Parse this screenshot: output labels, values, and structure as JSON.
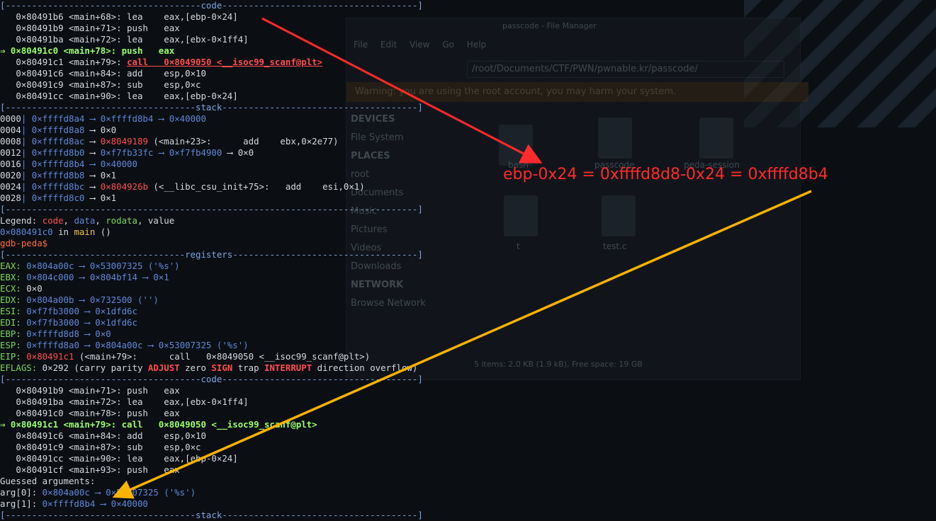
{
  "background": {
    "file_manager": {
      "title": "passcode - File Manager",
      "menu": [
        "File",
        "Edit",
        "View",
        "Go",
        "Help"
      ],
      "path": "/root/Documents/CTF/PWN/pwnable.kr/passcode/",
      "warning": "Warning: you are using the root account, you may harm your system.",
      "sidebar_devices_header": "DEVICES",
      "sidebar_places_header": "PLACES",
      "sidebar_network_header": "NETWORK",
      "sidebar_items": [
        "File System",
        "root",
        "Documents",
        "Music",
        "Pictures",
        "Videos",
        "Downloads"
      ],
      "network_item": "Browse Network",
      "files": [
        "bash",
        "passcode",
        "peda-session",
        "t",
        "test.c"
      ],
      "status": "5 items: 2.0 KB (1.9 kB), Free space: 19 GB"
    }
  },
  "terminal": {
    "sep_code": "[-------------------------------------code-------------------------------------]",
    "sep_stack": "[------------------------------------stack-------------------------------------]",
    "sep_regs": "[----------------------------------registers-----------------------------------]",
    "sep_end": "[------------------------------------------------------------------------------]",
    "code1": [
      {
        "prefix": "   ",
        "addr": "0×80491b6 <main+68>:",
        "op": " lea    eax,[ebp-0×24]"
      },
      {
        "prefix": "   ",
        "addr": "0×80491b9 <main+71>:",
        "op": " push   eax"
      },
      {
        "prefix": "   ",
        "addr": "0×80491ba <main+72>:",
        "op": " lea    eax,[ebx-0×1ff4]"
      }
    ],
    "code1_current": {
      "prefix": "⇒ ",
      "addr": "0×80491c0 <main+78>:",
      "op": " push   eax"
    },
    "code1_next": {
      "prefix": "   ",
      "addr": "0×80491c1 <main+79>:",
      "op": "call   0×8049050 <__isoc99_scanf@plt>"
    },
    "code1_after": [
      {
        "prefix": "   ",
        "addr": "0×80491c6 <main+84>:",
        "op": " add    esp,0×10"
      },
      {
        "prefix": "   ",
        "addr": "0×80491c9 <main+87>:",
        "op": " sub    esp,0×c"
      },
      {
        "prefix": "   ",
        "addr": "0×80491cc <main+90>:",
        "op": " lea    eax,[ebp-0×24]"
      }
    ],
    "stack": [
      {
        "off": "0000",
        "addr": "0×ffffd8a4",
        "rest": " ⟶ 0×ffffd8b4 ⟶ 0×40000",
        "hl": ""
      },
      {
        "off": "0004",
        "addr": "0×ffffd8a8",
        "rest": " ⟶ 0×0",
        "hl": ""
      },
      {
        "off": "0008",
        "addr": "0×ffffd8ac",
        "arrow": " ⟶ ",
        "hl": "0×8049189",
        "rest": " (<main+23>:      add    ebx,0×2e77)"
      },
      {
        "off": "0012",
        "addr": "0×ffffd8b0",
        "arrow": " ⟶ ",
        "hl2": "0×f7fb33fc ⟶ 0×f7fb4900",
        "rest": " ⟶ 0×0"
      },
      {
        "off": "0016",
        "addr": "0×ffffd8b4",
        "rest": " ⟶ 0×40000",
        "hl": ""
      },
      {
        "off": "0020",
        "addr": "0×ffffd8b8",
        "rest": " ⟶ 0×1",
        "hl": ""
      },
      {
        "off": "0024",
        "addr": "0×ffffd8bc",
        "arrow": " ⟶ ",
        "hl": "0×804926b",
        "rest": " (<__libc_csu_init+75>:   add    esi,0×1)"
      },
      {
        "off": "0028",
        "addr": "0×ffffd8c0",
        "rest": " ⟶ 0×1",
        "hl": ""
      }
    ],
    "legend_label": "Legend: ",
    "legend_code": "code",
    "legend_data": "data",
    "legend_rodata": "rodata",
    "legend_value": "value",
    "location_addr": "0×080491c0",
    "location_in": " in ",
    "location_func": "main",
    "location_tail": " ()",
    "prompt": "gdb-peda$",
    "registers": [
      {
        "name": "EAX:",
        "val": " 0×804a00c ⟶ 0×53007325 ('%s')"
      },
      {
        "name": "EBX:",
        "val": " 0×804c000 ⟶ 0×804bf14 ⟶ 0×1"
      },
      {
        "name": "ECX:",
        "val": " 0×0"
      },
      {
        "name": "EDX:",
        "val": " 0×804a00b ⟶ 0×732500 ('')"
      },
      {
        "name": "ESI:",
        "val": " 0×f7fb3000 ⟶ 0×1dfd6c"
      },
      {
        "name": "EDI:",
        "val": " 0×f7fb3000 ⟶ 0×1dfd6c"
      },
      {
        "name": "EBP:",
        "val": " 0×ffffd8d8 ⟶ 0×0"
      },
      {
        "name": "ESP:",
        "val": " 0×ffffd8a0 ⟶ 0×804a00c ⟶ 0×53007325 ('%s')"
      }
    ],
    "eip_name": "EIP:",
    "eip_addr": " 0×80491c1",
    "eip_rest": " (<main+79>:      call   0×8049050 <__isoc99_scanf@plt>)",
    "eflags_name": "EFLAGS:",
    "eflags_a": " 0×292 (carry parity ",
    "eflags_adjust": "ADJUST",
    "eflags_b": " zero ",
    "eflags_sign": "SIGN",
    "eflags_c": " trap ",
    "eflags_interrupt": "INTERRUPT",
    "eflags_d": " direction overflow)",
    "code2": [
      {
        "prefix": "   ",
        "addr": "0×80491b9 <main+71>:",
        "op": " push   eax"
      },
      {
        "prefix": "   ",
        "addr": "0×80491ba <main+72>:",
        "op": " lea    eax,[ebx-0×1ff4]"
      },
      {
        "prefix": "   ",
        "addr": "0×80491c0 <main+78>:",
        "op": " push   eax"
      }
    ],
    "code2_current": {
      "prefix": "⇒ ",
      "addr": "0×80491c1 <main+79>:",
      "op": " call   0×8049050 <__isoc99_scanf@plt>"
    },
    "code2_after": [
      {
        "prefix": "   ",
        "addr": "0×80491c6 <main+84>:",
        "op": " add    esp,0×10"
      },
      {
        "prefix": "   ",
        "addr": "0×80491c9 <main+87>:",
        "op": " sub    esp,0×c"
      },
      {
        "prefix": "   ",
        "addr": "0×80491cc <main+90>:",
        "op": " lea    eax,[ebp-0×24]"
      },
      {
        "prefix": "   ",
        "addr": "0×80491cf <main+93>:",
        "op": " push   eax"
      }
    ],
    "guessed": "Guessed arguments:",
    "args": [
      {
        "name": "arg[0]:",
        "addr": " 0×804a00c",
        "rest": " ⟶ 0×53007325 ('%s')"
      },
      {
        "name": "arg[1]:",
        "addr": " 0×ffffd8b4",
        "rest": " ⟶ 0×40000"
      }
    ],
    "sep_stack_partial": "[------------------------------------stack-------------------------------------]"
  },
  "annotation": {
    "text": "ebp-0x24 = 0xffffd8d8-0x24 = 0xffffd8b4",
    "color_red": "#ff2a2a",
    "color_yellow": "#ffb300"
  }
}
